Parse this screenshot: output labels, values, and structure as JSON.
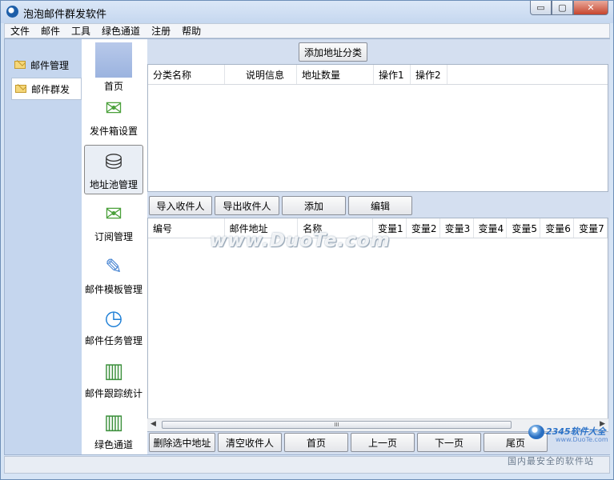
{
  "window": {
    "title": "泡泡邮件群发软件",
    "min": "▭",
    "max": "▢",
    "close": "✕"
  },
  "menu": [
    "文件",
    "邮件",
    "工具",
    "绿色通道",
    "注册",
    "帮助"
  ],
  "leftnav": [
    {
      "label": "邮件管理",
      "icon": "envelope-icon"
    },
    {
      "label": "邮件群发",
      "icon": "envelope-icon",
      "active": true
    }
  ],
  "toolbar": [
    {
      "label": "首页",
      "icon": "home-icon"
    },
    {
      "label": "发件箱设置",
      "icon": "outbox-icon"
    },
    {
      "label": "地址池管理",
      "icon": "database-icon",
      "selected": true
    },
    {
      "label": "订阅管理",
      "icon": "subscription-icon"
    },
    {
      "label": "邮件模板管理",
      "icon": "template-icon"
    },
    {
      "label": "邮件任务管理",
      "icon": "clock-icon"
    },
    {
      "label": "邮件跟踪统计",
      "icon": "bar-chart-icon"
    },
    {
      "label": "绿色通道",
      "icon": "bar-chart-icon"
    }
  ],
  "category": {
    "add_button": "添加地址分类",
    "columns": [
      "分类名称",
      "说明信息",
      "地址数量",
      "操作1",
      "操作2"
    ]
  },
  "actions": {
    "import": "导入收件人",
    "export": "导出收件人",
    "add": "添加",
    "edit": "编辑"
  },
  "recipients": {
    "columns": [
      "编号",
      "邮件地址",
      "名称",
      "变量1",
      "变量2",
      "变量3",
      "变量4",
      "变量5",
      "变量6",
      "变量7"
    ],
    "scroll_thumb": "III"
  },
  "bottom": {
    "delete": "删除选中地址",
    "clear": "清空收件人",
    "first": "首页",
    "prev": "上一页",
    "next": "下一页",
    "last": "尾页"
  },
  "watermark": "www.DuoTe.com",
  "site_logo": {
    "brand": "2345软件大全",
    "url": "www.DuoTe.com",
    "tagline": "国内最安全的软件站"
  },
  "colors": {
    "nav_bg": "#c5d6ee",
    "panel_bg": "#d4dff0",
    "close": "#c6452e"
  }
}
